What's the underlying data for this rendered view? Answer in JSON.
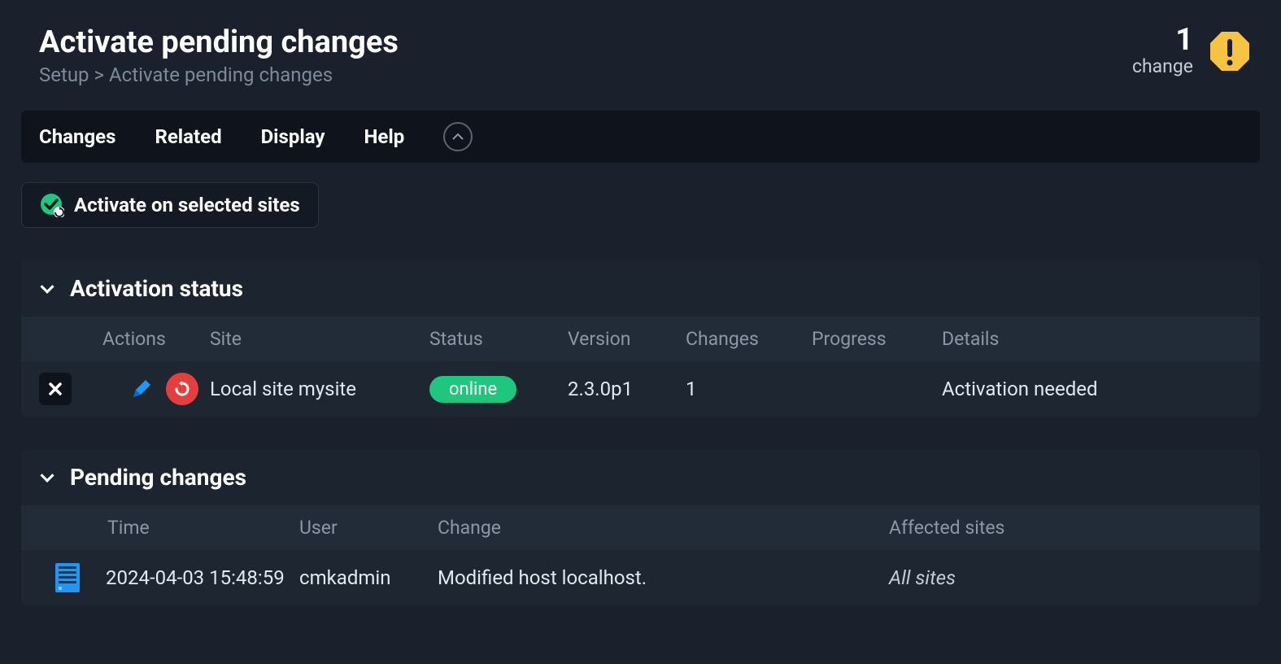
{
  "header": {
    "title": "Activate pending changes",
    "breadcrumb": "Setup > Activate pending changes",
    "change_count": "1",
    "change_label": "change"
  },
  "menubar": {
    "items": [
      "Changes",
      "Related",
      "Display",
      "Help"
    ]
  },
  "activate_button": "Activate on selected sites",
  "activation_section": {
    "title": "Activation status",
    "columns": [
      "Actions",
      "Site",
      "Status",
      "Version",
      "Changes",
      "Progress",
      "Details"
    ],
    "row": {
      "site": "Local site mysite",
      "status": "online",
      "version": "2.3.0p1",
      "changes": "1",
      "progress": "",
      "details": "Activation needed"
    }
  },
  "pending_section": {
    "title": "Pending changes",
    "columns": [
      "Time",
      "User",
      "Change",
      "Affected sites"
    ],
    "row": {
      "time": "2024-04-03 15:48:59",
      "user": "cmkadmin",
      "change": "Modified host localhost.",
      "affected": "All sites"
    }
  }
}
